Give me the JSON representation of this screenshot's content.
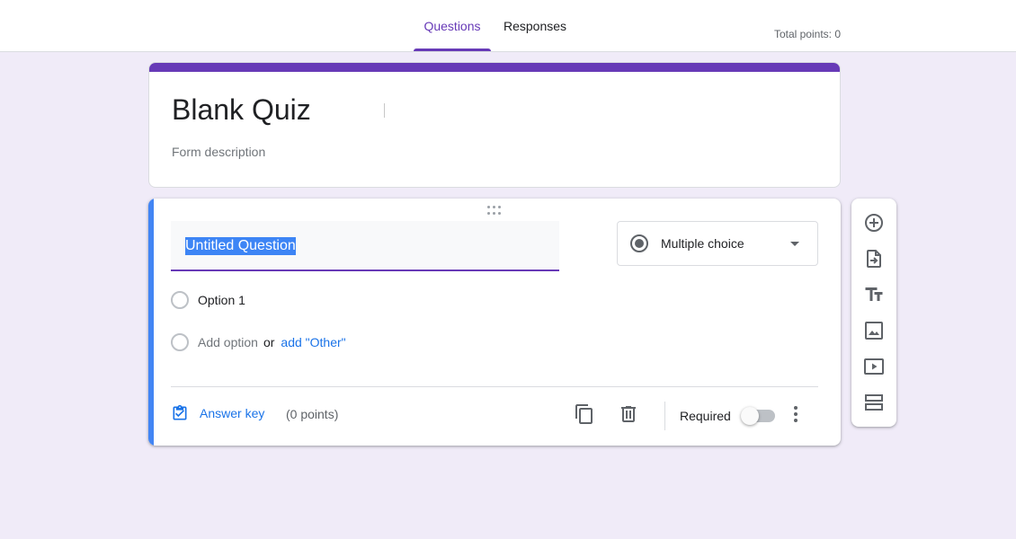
{
  "header": {
    "tabs": [
      {
        "label": "Questions",
        "active": true
      },
      {
        "label": "Responses",
        "active": false
      }
    ],
    "total_points": "Total points: 0"
  },
  "form": {
    "title": "Blank Quiz",
    "description_placeholder": "Form description"
  },
  "question": {
    "title": "Untitled Question",
    "type": "Multiple choice",
    "options": [
      "Option 1"
    ],
    "add_option": "Add option",
    "or": "or",
    "add_other": "add \"Other\"",
    "answer_key": "Answer key",
    "points": "(0 points)",
    "required_label": "Required",
    "required": false
  },
  "toolbar": {
    "items": [
      "add-question-icon",
      "import-questions-icon",
      "add-title-icon",
      "add-image-icon",
      "add-video-icon",
      "add-section-icon"
    ]
  },
  "colors": {
    "theme": "#673ab7",
    "background": "#f0ebf8",
    "active_accent": "#4285f4",
    "link": "#1a73e8"
  }
}
